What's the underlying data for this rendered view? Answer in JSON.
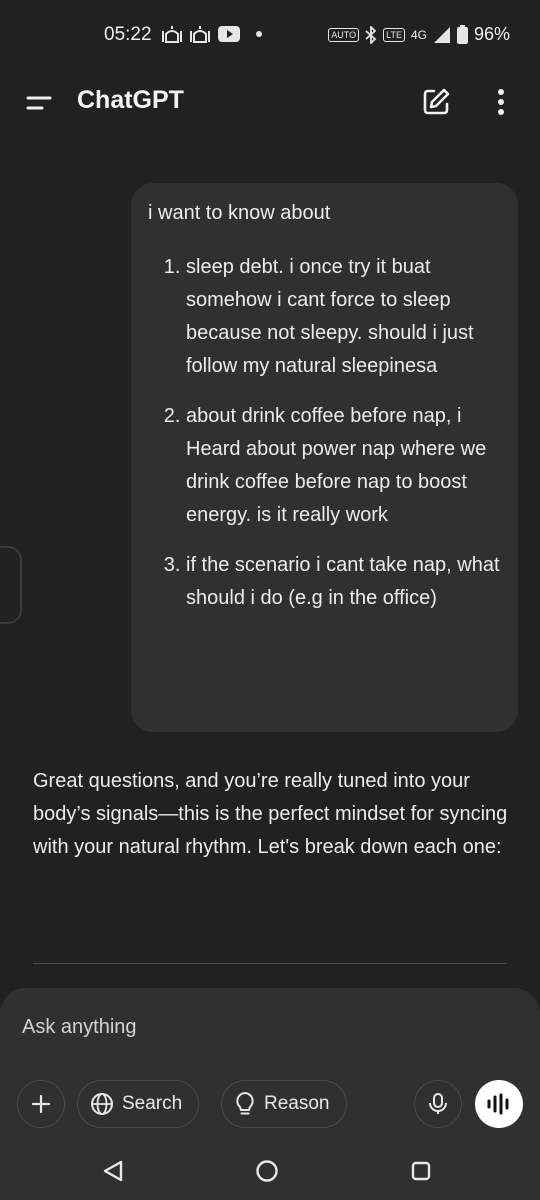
{
  "status_bar": {
    "time": "05:22",
    "battery": "96%",
    "network": "4G",
    "icons": [
      "prayer-app-icon",
      "prayer-app-icon",
      "youtube-icon",
      "notification-dot",
      "auto-brightness-icon",
      "bluetooth-icon",
      "volte-icon",
      "signal-icon",
      "battery-icon"
    ],
    "auto_label": "AUTO",
    "volte_label": "LTE"
  },
  "app_bar": {
    "title": "ChatGPT"
  },
  "conversation": {
    "user_message": {
      "intro": "i want to know about",
      "items": [
        "sleep debt. i once try it buat somehow i cant force to sleep because not sleepy. should i just follow my natural sleepinesa",
        "about drink coffee before nap, i Heard about power nap where we drink coffee before nap to boost energy. is it really work",
        "if the scenario i cant take nap, what should i do (e.g in the office)"
      ]
    },
    "assistant_message": "Great questions, and you’re really tuned into your body’s signals—this is the perfect mindset for syncing with your natural rhythm. Let's break down each one:"
  },
  "composer": {
    "placeholder": "Ask anything",
    "search_label": "Search",
    "reason_label": "Reason"
  },
  "colors": {
    "background": "#212121",
    "bubble": "#303030",
    "text": "#ececec",
    "voice_button": "#ffffff"
  }
}
